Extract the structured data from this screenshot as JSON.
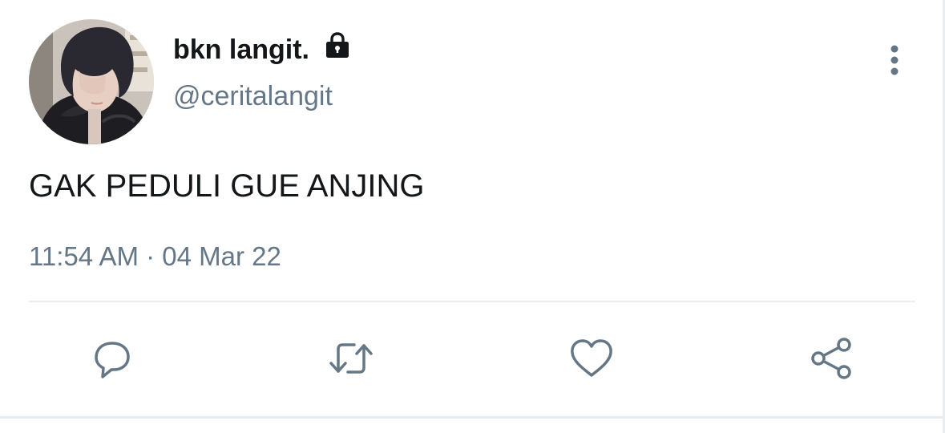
{
  "user": {
    "display_name": "bkn langit.",
    "handle": "@ceritalangit",
    "protected_icon": "lock-icon",
    "avatar": "profile-photo"
  },
  "tweet": {
    "text": "GAK PEDULI GUE ANJING",
    "timestamp": "11:54 AM · 04 Mar 22"
  },
  "actions": {
    "reply_icon": "reply-icon",
    "retweet_icon": "retweet-icon",
    "like_icon": "heart-icon",
    "share_icon": "share-icon",
    "more_icon": "more-vertical-icon"
  },
  "colors": {
    "text_primary": "#14171a",
    "text_secondary": "#657786",
    "divider": "#e6ecf0",
    "background": "#ffffff"
  }
}
